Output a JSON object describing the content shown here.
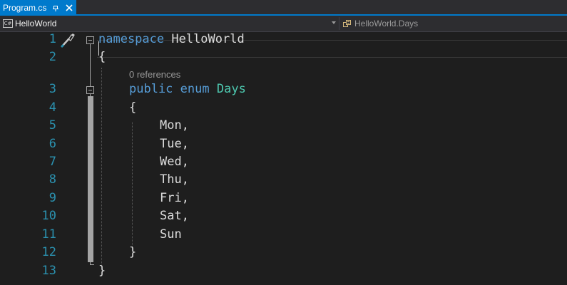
{
  "tab": {
    "title": "Program.cs",
    "pin_icon": "pin-icon",
    "close_icon": "close-icon"
  },
  "navbar": {
    "project_icon": "csharp-project-icon",
    "project_badge": "C#",
    "project": "HelloWorld",
    "member_icon": "enum-member-icon",
    "member": "HelloWorld.Days"
  },
  "editor": {
    "line_numbers": [
      "1",
      "2",
      "3",
      "4",
      "5",
      "6",
      "7",
      "8",
      "9",
      "10",
      "11",
      "12",
      "13"
    ],
    "codelens": "0 references",
    "lines": [
      {
        "kw": "namespace",
        "rest": " HelloWorld"
      },
      {
        "text": "{"
      },
      {
        "kw1": "public",
        "kw2": "enum",
        "type": "Days"
      },
      {
        "text": "{"
      },
      {
        "text": "Mon,"
      },
      {
        "text": "Tue,"
      },
      {
        "text": "Wed,"
      },
      {
        "text": "Thu,"
      },
      {
        "text": "Fri,"
      },
      {
        "text": "Sat,"
      },
      {
        "text": "Sun"
      },
      {
        "text": "}"
      },
      {
        "text": "}"
      }
    ],
    "lightbulb_icon": "quick-actions-brush-icon"
  },
  "colors": {
    "accent": "#007acc",
    "keyword": "#569cd6",
    "type": "#4ec9b0",
    "line_number": "#2b91af",
    "text": "#dcdcdc",
    "background": "#1e1e1e"
  }
}
